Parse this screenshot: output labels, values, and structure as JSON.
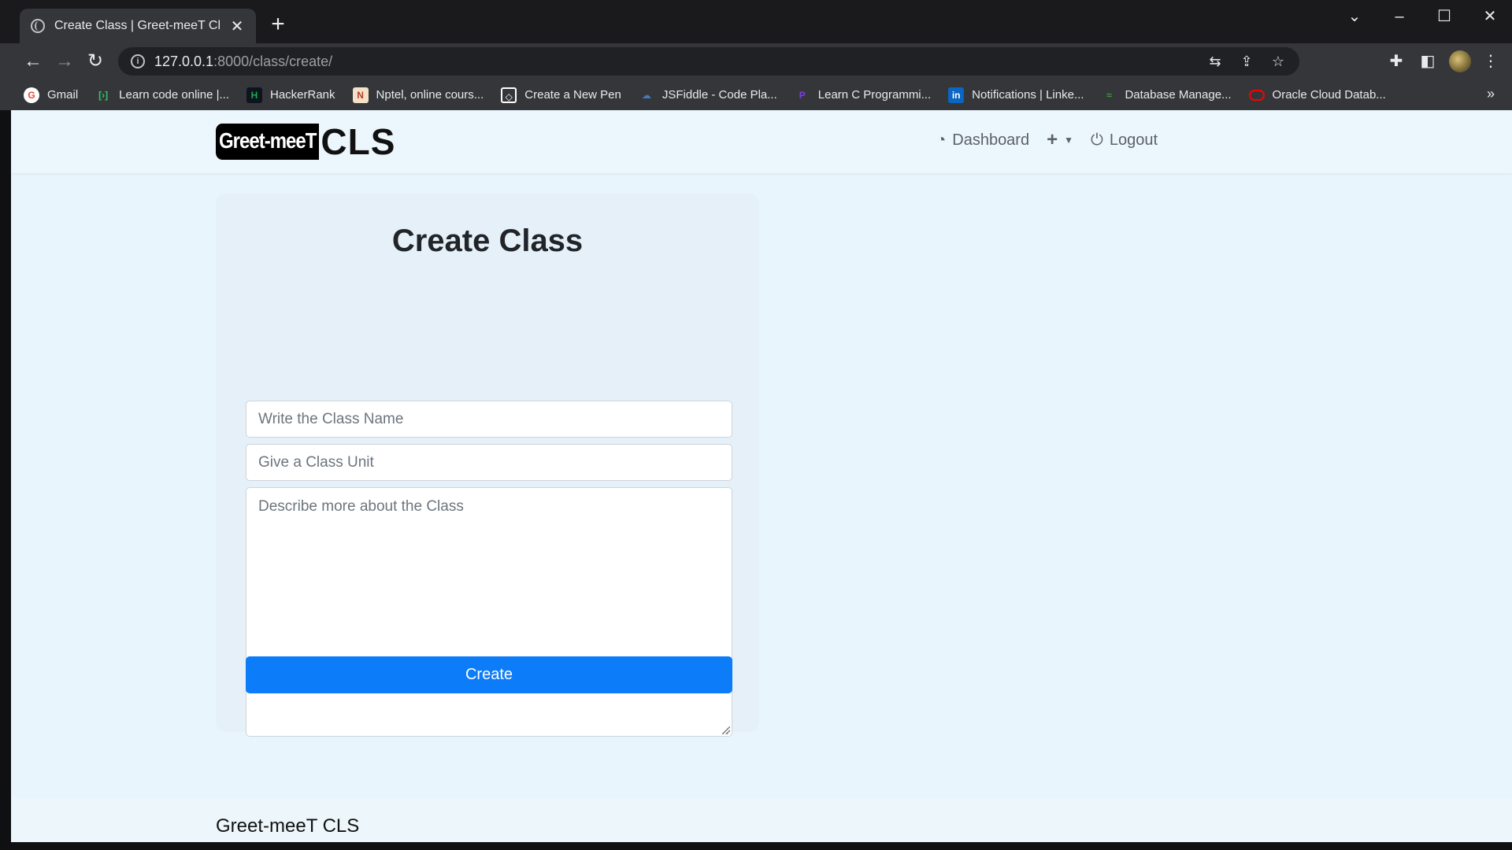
{
  "browser": {
    "tab_title": "Create Class | Greet-meeT Classroom",
    "tab_close": "✕",
    "new_tab": "+",
    "url_host": "127.0.0.1",
    "url_path": ":8000/class/create/",
    "bookmarks": [
      {
        "label": "Gmail",
        "icon": "google-icon",
        "color": "#ea4335"
      },
      {
        "label": "Learn code online |...",
        "icon": "code-icon",
        "color": "#2ec866"
      },
      {
        "label": "HackerRank",
        "icon": "hackerrank-icon",
        "color": "#1ba94c"
      },
      {
        "label": "Nptel, online cours...",
        "icon": "nptel-icon",
        "color": "#c0392b"
      },
      {
        "label": "Create a New Pen",
        "icon": "codepen-icon",
        "color": "#ffffff"
      },
      {
        "label": "JSFiddle - Code Pla...",
        "icon": "jsfiddle-icon",
        "color": "#4679bd"
      },
      {
        "label": "Learn C Programmi...",
        "icon": "programiz-icon",
        "color": "#7b3fe4"
      },
      {
        "label": "Notifications | Linke...",
        "icon": "linkedin-icon",
        "color": "#0a66c2"
      },
      {
        "label": "Database Manage...",
        "icon": "database-icon",
        "color": "#3c9a3c"
      },
      {
        "label": "Oracle Cloud Datab...",
        "icon": "oracle-icon",
        "color": "#f80000"
      }
    ],
    "bookmarks_more": "»"
  },
  "site": {
    "logo_badge": "Greet-meeT",
    "logo_text": "CLS",
    "nav": {
      "dashboard": "Dashboard",
      "logout": "Logout"
    }
  },
  "form": {
    "title": "Create Class",
    "class_name_placeholder": "Write the Class Name",
    "class_unit_placeholder": "Give a Class Unit",
    "description_placeholder": "Describe more about the Class",
    "submit_label": "Create"
  },
  "footer": {
    "brand": "Greet-meeT CLS"
  },
  "colors": {
    "primary_button": "#0d7cf8",
    "page_background": "#e9f5fd"
  }
}
